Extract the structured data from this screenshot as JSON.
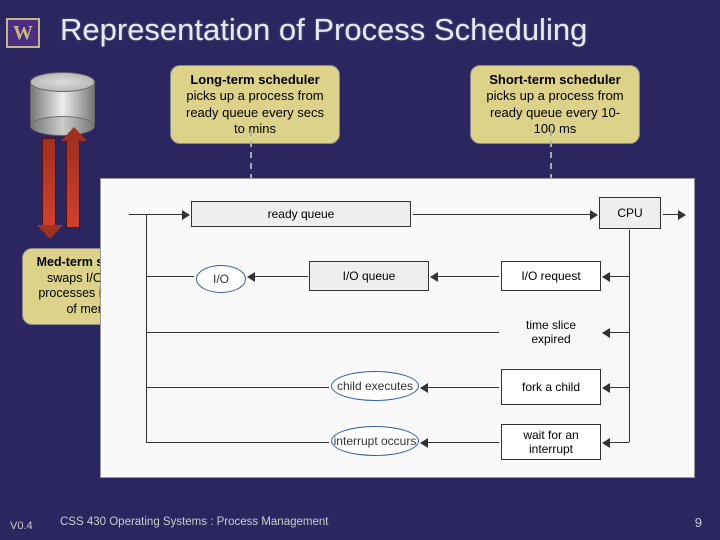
{
  "title": "Representation of Process Scheduling",
  "logo_letter": "W",
  "callouts": {
    "long": {
      "title": "Long-term scheduler",
      "body": "picks up a process from ready queue every secs to mins"
    },
    "short": {
      "title": "Short-term scheduler",
      "body": "picks up a process from ready queue every 10-100 ms"
    },
    "med": {
      "title": "Med-term scheduler",
      "body": "swaps I/O waiting processes in and out of memory"
    }
  },
  "diagram": {
    "ready_queue": "ready queue",
    "cpu": "CPU",
    "io": "I/O",
    "io_queue": "I/O queue",
    "io_request": "I/O request",
    "time_slice": "time slice expired",
    "child_exec": "child executes",
    "fork": "fork a child",
    "int_occurs": "interrupt occurs",
    "wait_int": "wait for an interrupt"
  },
  "footer": "CSS 430 Operating Systems : Process Management",
  "version": "V0.4",
  "page_number": "9"
}
